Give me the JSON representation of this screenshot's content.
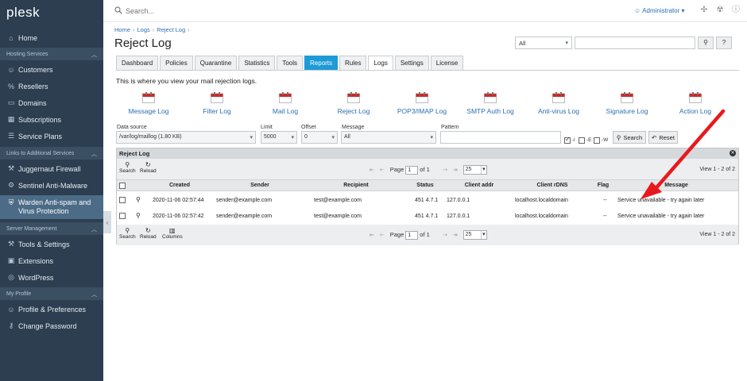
{
  "app": {
    "logo": "plesk"
  },
  "sidebar": {
    "home": "Home",
    "sections": [
      {
        "label": "Hosting Services",
        "items": [
          "Customers",
          "Resellers",
          "Domains",
          "Subscriptions",
          "Service Plans"
        ]
      },
      {
        "label": "Links to Additional Services",
        "items": [
          "Juggernaut Firewall",
          "Sentinel Anti-Malware",
          "Warden Anti-spam and Virus Protection"
        ]
      },
      {
        "label": "Server Management",
        "items": [
          "Tools & Settings",
          "Extensions",
          "WordPress"
        ]
      },
      {
        "label": "My Profile",
        "items": [
          "Profile & Preferences",
          "Change Password"
        ]
      }
    ]
  },
  "header": {
    "search_placeholder": "Search...",
    "user": "Administrator"
  },
  "breadcrumbs": [
    "Home",
    "Logs",
    "Reject Log"
  ],
  "page": {
    "title": "Reject Log",
    "intro": "This is where you view your mail rejection logs.",
    "filter_option": "All",
    "search_button_glyph": "⚲",
    "help_button": "?"
  },
  "tabs": [
    "Dashboard",
    "Policies",
    "Quarantine",
    "Statistics",
    "Tools",
    "Reports",
    "Rules",
    "Logs",
    "Settings",
    "License"
  ],
  "log_links": [
    "Message Log",
    "Filter Log",
    "Mail Log",
    "Reject Log",
    "POP3/IMAP Log",
    "SMTP Auth Log",
    "Anti-virus Log",
    "Signature Log",
    "Action Log"
  ],
  "form": {
    "data_source_label": "Data source",
    "data_source_value": "/var/log/maillog (1.80 KB)",
    "limit_label": "Limit",
    "limit_value": "5000",
    "offset_label": "Offset",
    "offset_value": "0",
    "message_label": "Message",
    "message_value": "All",
    "pattern_label": "Pattern",
    "chk_i": "-i",
    "chk_e": "-E",
    "chk_w": "-W",
    "search_button": "Search",
    "reset_button": "Reset"
  },
  "grid": {
    "title": "Reject Log",
    "toolbar_top": [
      "Search",
      "Reload"
    ],
    "toolbar_bottom": [
      "Search",
      "Reload",
      "Columns"
    ],
    "page_label": "Page",
    "page_value": "1",
    "of_label": "of 1",
    "page_size": "25",
    "view_count": "View 1 - 2 of 2",
    "columns": [
      "Created",
      "Sender",
      "Recipient",
      "Status",
      "Client addr",
      "Client rDNS",
      "Flag",
      "Message"
    ],
    "rows": [
      {
        "created": "2020-11-06 02:57:44",
        "sender": "sender@example.com",
        "recipient": "test@example.com",
        "status": "451 4.7.1",
        "addr": "127.0.0.1",
        "rdns": "localhost.localdomain",
        "flag": "--",
        "message": "Service unavailable - try again later"
      },
      {
        "created": "2020-11-06 02:57:42",
        "sender": "sender@example.com",
        "recipient": "test@example.com",
        "status": "451 4.7.1",
        "addr": "127.0.0.1",
        "rdns": "localhost.localdomain",
        "flag": "--",
        "message": "Service unavailable - try again later"
      }
    ]
  },
  "colors": {
    "sidebar": "#2c3e50",
    "active_tab": "#1e9ad6",
    "link": "#2a6fb4",
    "arrow": "#e8191d"
  }
}
